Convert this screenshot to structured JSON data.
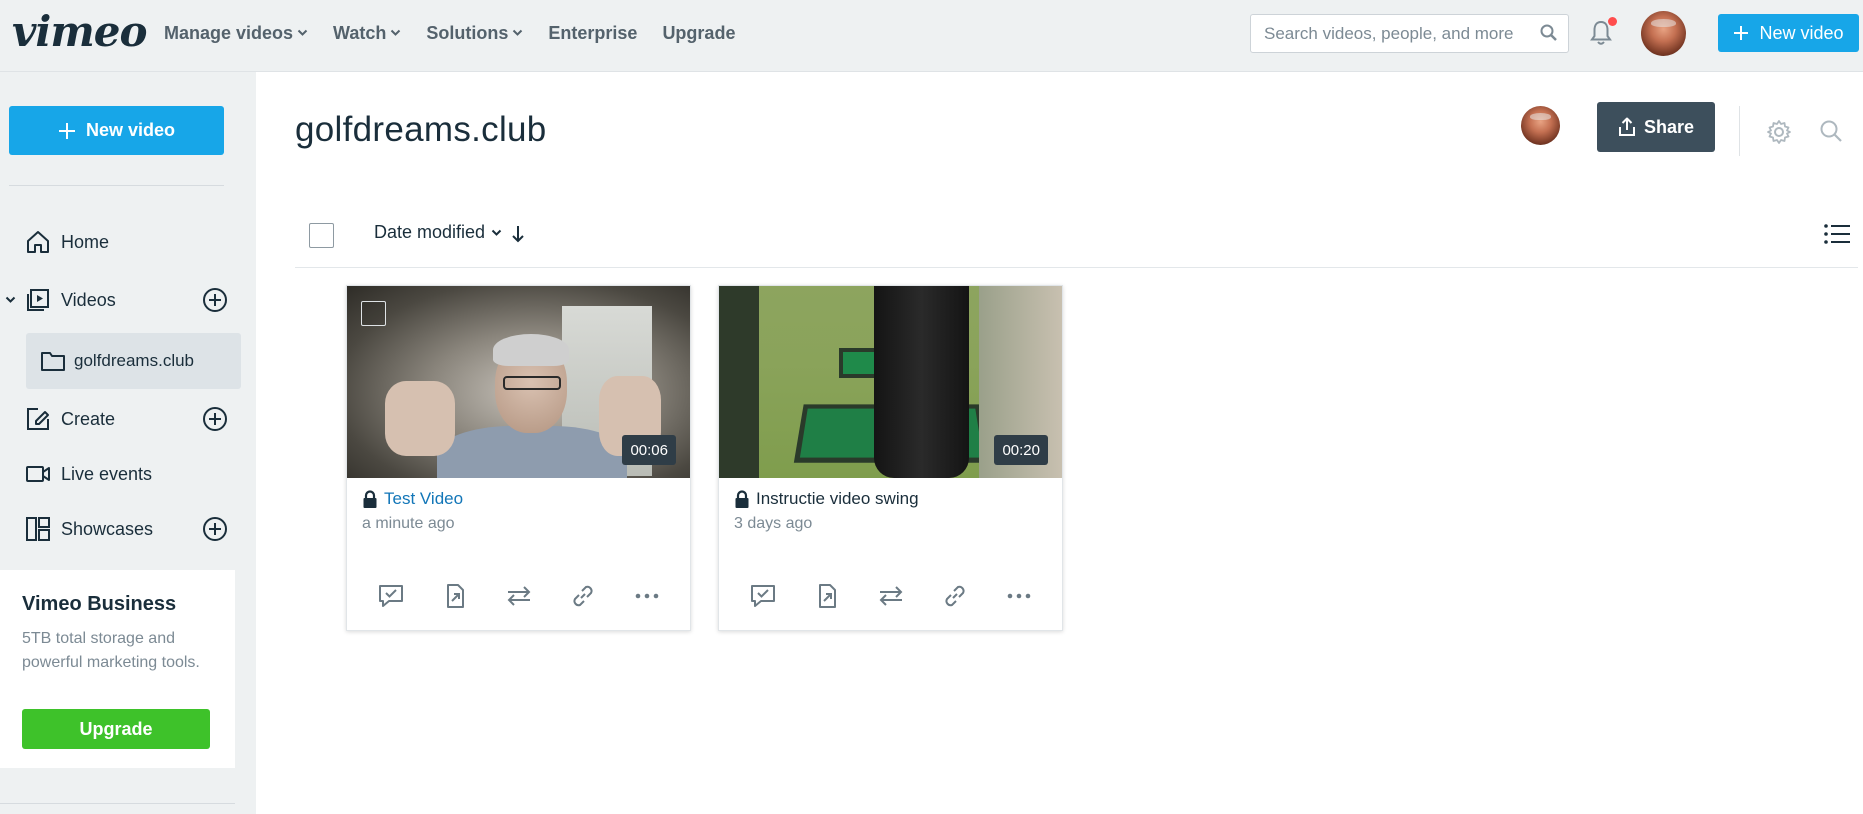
{
  "header": {
    "logo": "vimeo",
    "nav": [
      "Manage videos",
      "Watch",
      "Solutions",
      "Enterprise",
      "Upgrade"
    ],
    "search_placeholder": "Search videos, people, and more",
    "new_video_label": "New video"
  },
  "sidebar": {
    "new_video_label": "New video",
    "items": {
      "home": "Home",
      "videos": "Videos",
      "folder": "golfdreams.club",
      "create": "Create",
      "live": "Live events",
      "showcases": "Showcases"
    },
    "business": {
      "title": "Vimeo Business",
      "description": "5TB total storage and powerful marketing tools.",
      "upgrade_label": "Upgrade"
    }
  },
  "main": {
    "title": "golfdreams.club",
    "share_label": "Share",
    "sort_label": "Date modified",
    "videos": [
      {
        "title": "Test Video",
        "time": "a minute ago",
        "duration": "00:06",
        "privacy": "lock-icon"
      },
      {
        "title": "Instructie video swing",
        "time": "3 days ago",
        "duration": "00:20",
        "privacy": "lock-icon"
      }
    ]
  },
  "colors": {
    "accent_blue": "#17a6e8",
    "upgrade_green": "#3ec22a",
    "share_dark": "#3d4f5c",
    "link_blue": "#1276b8",
    "notification_red": "#ff4d4d"
  }
}
